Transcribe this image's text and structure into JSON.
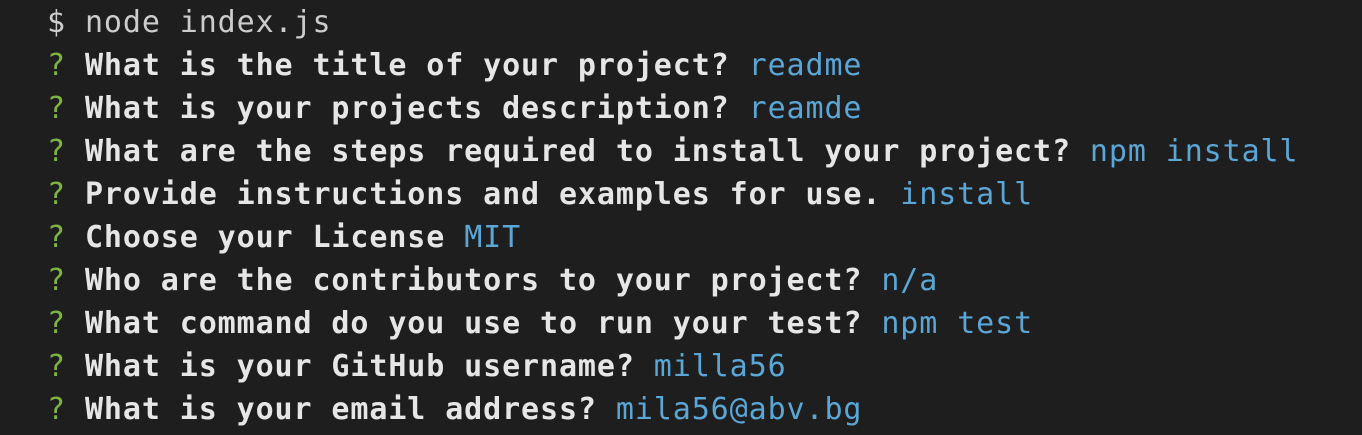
{
  "terminal": {
    "command_line": {
      "prompt": "$",
      "command": "node index.js"
    },
    "lines": [
      {
        "marker": "?",
        "question": "What is the title of your project?",
        "answer": "readme"
      },
      {
        "marker": "?",
        "question": "What is your projects description?",
        "answer": "reamde"
      },
      {
        "marker": "?",
        "question": "What are the steps required to install your project?",
        "answer": "npm install"
      },
      {
        "marker": "?",
        "question": "Provide instructions and examples for use.",
        "answer": "install"
      },
      {
        "marker": "?",
        "question": "Choose your License",
        "answer": "MIT"
      },
      {
        "marker": "?",
        "question": "Who are the contributors to your project?",
        "answer": "n/a"
      },
      {
        "marker": "?",
        "question": "What command do you use to run your test?",
        "answer": "npm test"
      },
      {
        "marker": "?",
        "question": "What is your GitHub username?",
        "answer": "milla56"
      },
      {
        "marker": "?",
        "question": "What is your email address?",
        "answer": "mila56@abv.bg"
      }
    ]
  },
  "colors": {
    "background": "#1e1e1e",
    "marker": "#7cb342",
    "question": "#e6e6e6",
    "answer": "#5aa6d6",
    "command": "#cccccc"
  }
}
